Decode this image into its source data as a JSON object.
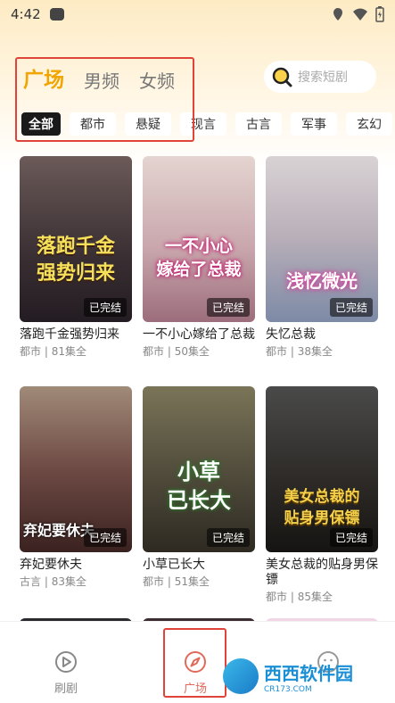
{
  "status_bar": {
    "time": "4:42"
  },
  "header": {
    "tabs": [
      {
        "label": "广场",
        "active": true
      },
      {
        "label": "男频",
        "active": false
      },
      {
        "label": "女频",
        "active": false
      }
    ],
    "search_placeholder": "搜索短剧"
  },
  "genres": [
    {
      "label": "全部",
      "active": true
    },
    {
      "label": "都市",
      "active": false
    },
    {
      "label": "悬疑",
      "active": false
    },
    {
      "label": "现言",
      "active": false
    },
    {
      "label": "古言",
      "active": false
    },
    {
      "label": "军事",
      "active": false
    },
    {
      "label": "玄幻",
      "active": false
    }
  ],
  "dramas": [
    {
      "title": "落跑千金强势归来",
      "genre": "都市",
      "episodes": "81集全",
      "status": "已完结",
      "poster_text": "落跑千金\n强势归来",
      "colors": [
        "#5a4a4a",
        "#2a2428"
      ]
    },
    {
      "title": "一不小心嫁给了总裁",
      "genre": "都市",
      "episodes": "50集全",
      "status": "已完结",
      "poster_text": "一不小心\n嫁给了总裁",
      "colors": [
        "#d9c4c0",
        "#a57a84"
      ]
    },
    {
      "title": "失忆总裁",
      "genre": "都市",
      "episodes": "38集全",
      "status": "已完结",
      "poster_text": "浅忆微光",
      "colors": [
        "#cfc6cb",
        "#7a8aa2"
      ]
    },
    {
      "title": "弃妃要休夫",
      "genre": "古言",
      "episodes": "83集全",
      "status": "已完结",
      "poster_text": "弃妃要休夫",
      "colors": [
        "#8a5a52",
        "#3c2320"
      ]
    },
    {
      "title": "小草已长大",
      "genre": "都市",
      "episodes": "51集全",
      "status": "已完结",
      "poster_text": "小草\n已长大",
      "colors": [
        "#6a6a52",
        "#3a342a"
      ]
    },
    {
      "title": "美女总裁的贴身男保镖",
      "genre": "都市",
      "episodes": "85集全",
      "status": "已完结",
      "poster_text": "美女总裁的\n贴身男保镖",
      "colors": [
        "#3a3a3a",
        "#1c1a18"
      ]
    }
  ],
  "bottom_nav": [
    {
      "label": "刷剧",
      "icon": "play-circle-icon",
      "active": false
    },
    {
      "label": "广场",
      "icon": "compass-icon",
      "active": true
    }
  ],
  "watermark": {
    "text": "西西软件园",
    "sub": "CR173.COM"
  },
  "colors": {
    "accent": "#f0a500",
    "highlight_box": "#e0433a",
    "nav_active": "#e06a5a"
  }
}
